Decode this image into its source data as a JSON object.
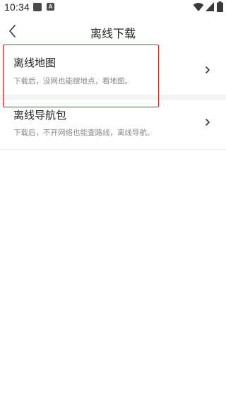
{
  "status_bar": {
    "time": "10:34",
    "a_icon_glyph": "A",
    "icons": [
      "stop-icon",
      "a-icon",
      "wifi-icon",
      "signal-icon",
      "battery-icon"
    ]
  },
  "header": {
    "title": "离线下载",
    "back_icon": "back-icon"
  },
  "items": [
    {
      "title": "离线地图",
      "description": "下载后，没网也能搜地点，看地图。",
      "icon": "chevron-right-icon"
    },
    {
      "title": "离线导航包",
      "description": "下载后，不开网络也能查路线，离线导航。",
      "icon": "chevron-right-icon"
    }
  ],
  "colors": {
    "highlight": "#e02020",
    "title_text": "#222222",
    "desc_text": "#8a8a8a",
    "separator": "#f4f4f4"
  }
}
